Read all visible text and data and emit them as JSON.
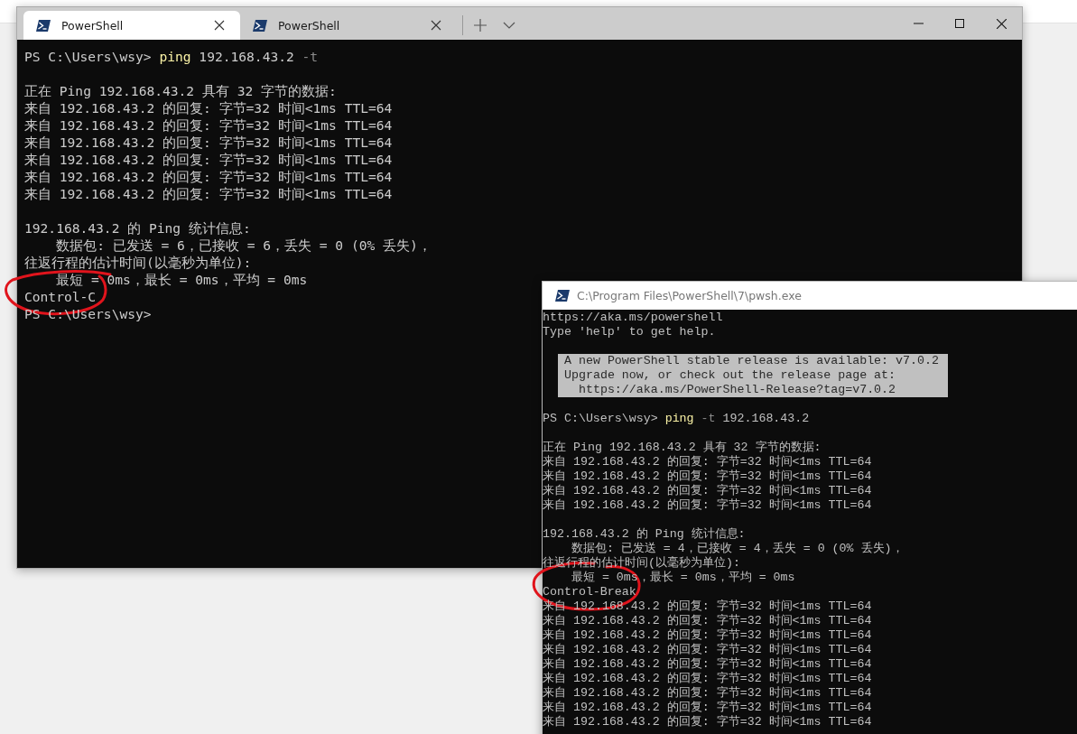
{
  "terminal": {
    "tabs": [
      {
        "title": "PowerShell",
        "selected": true
      },
      {
        "title": "PowerShell",
        "selected": false
      }
    ],
    "lines": [
      {
        "kind": "command",
        "parts": [
          {
            "text": "PS C:\\Users\\wsy>",
            "kind": "word"
          },
          {
            "text": "ping",
            "kind": "command"
          },
          {
            "text": "192.168.43.2",
            "kind": "word"
          },
          {
            "text": "-t",
            "kind": "flag"
          }
        ]
      },
      {
        "kind": "blank"
      },
      {
        "kind": "text",
        "text": "正在 Ping 192.168.43.2 具有 32 字节的数据:"
      },
      {
        "kind": "text",
        "text": "来自 192.168.43.2 的回复: 字节=32 时间<1ms TTL=64"
      },
      {
        "kind": "text",
        "text": "来自 192.168.43.2 的回复: 字节=32 时间<1ms TTL=64"
      },
      {
        "kind": "text",
        "text": "来自 192.168.43.2 的回复: 字节=32 时间<1ms TTL=64"
      },
      {
        "kind": "text",
        "text": "来自 192.168.43.2 的回复: 字节=32 时间<1ms TTL=64"
      },
      {
        "kind": "text",
        "text": "来自 192.168.43.2 的回复: 字节=32 时间<1ms TTL=64"
      },
      {
        "kind": "text",
        "text": "来自 192.168.43.2 的回复: 字节=32 时间<1ms TTL=64"
      },
      {
        "kind": "blank"
      },
      {
        "kind": "text",
        "text": "192.168.43.2 的 Ping 统计信息:"
      },
      {
        "kind": "text",
        "text": "    数据包: 已发送 = 6，已接收 = 6，丢失 = 0 (0% 丢失)，"
      },
      {
        "kind": "text",
        "text": "往返行程的估计时间(以毫秒为单位):"
      },
      {
        "kind": "text",
        "text": "    最短 = 0ms，最长 = 0ms，平均 = 0ms"
      },
      {
        "kind": "text",
        "text": "Control-C"
      },
      {
        "kind": "command",
        "parts": [
          {
            "text": "PS C:\\Users\\wsy>",
            "kind": "word"
          }
        ]
      }
    ]
  },
  "console": {
    "title": "C:\\Program Files\\PowerShell\\7\\pwsh.exe",
    "lines": [
      {
        "kind": "text",
        "text": "https://aka.ms/powershell"
      },
      {
        "kind": "text",
        "text": "Type 'help' to get help."
      },
      {
        "kind": "blank"
      },
      {
        "kind": "notice",
        "lines": [
          "A new PowerShell stable release is available: v7.0.2",
          "Upgrade now, or check out the release page at:",
          "  https://aka.ms/PowerShell-Release?tag=v7.0.2"
        ]
      },
      {
        "kind": "blank"
      },
      {
        "kind": "command",
        "parts": [
          {
            "text": "PS C:\\Users\\wsy>",
            "kind": "word"
          },
          {
            "text": "ping",
            "kind": "command"
          },
          {
            "text": "-t",
            "kind": "flag"
          },
          {
            "text": "192.168.43.2",
            "kind": "word"
          }
        ]
      },
      {
        "kind": "blank"
      },
      {
        "kind": "text",
        "text": "正在 Ping 192.168.43.2 具有 32 字节的数据:"
      },
      {
        "kind": "text",
        "text": "来自 192.168.43.2 的回复: 字节=32 时间<1ms TTL=64"
      },
      {
        "kind": "text",
        "text": "来自 192.168.43.2 的回复: 字节=32 时间<1ms TTL=64"
      },
      {
        "kind": "text",
        "text": "来自 192.168.43.2 的回复: 字节=32 时间<1ms TTL=64"
      },
      {
        "kind": "text",
        "text": "来自 192.168.43.2 的回复: 字节=32 时间<1ms TTL=64"
      },
      {
        "kind": "blank"
      },
      {
        "kind": "text",
        "text": "192.168.43.2 的 Ping 统计信息:"
      },
      {
        "kind": "text",
        "text": "    数据包: 已发送 = 4，已接收 = 4，丢失 = 0 (0% 丢失)，"
      },
      {
        "kind": "text",
        "text": "往返行程的估计时间(以毫秒为单位):"
      },
      {
        "kind": "text",
        "text": "    最短 = 0ms，最长 = 0ms，平均 = 0ms"
      },
      {
        "kind": "text",
        "text": "Control-Break"
      },
      {
        "kind": "text",
        "text": "来自 192.168.43.2 的回复: 字节=32 时间<1ms TTL=64"
      },
      {
        "kind": "text",
        "text": "来自 192.168.43.2 的回复: 字节=32 时间<1ms TTL=64"
      },
      {
        "kind": "text",
        "text": "来自 192.168.43.2 的回复: 字节=32 时间<1ms TTL=64"
      },
      {
        "kind": "text",
        "text": "来自 192.168.43.2 的回复: 字节=32 时间<1ms TTL=64"
      },
      {
        "kind": "text",
        "text": "来自 192.168.43.2 的回复: 字节=32 时间<1ms TTL=64"
      },
      {
        "kind": "text",
        "text": "来自 192.168.43.2 的回复: 字节=32 时间<1ms TTL=64"
      },
      {
        "kind": "text",
        "text": "来自 192.168.43.2 的回复: 字节=32 时间<1ms TTL=64"
      },
      {
        "kind": "text",
        "text": "来自 192.168.43.2 的回复: 字节=32 时间<1ms TTL=64"
      },
      {
        "kind": "text",
        "text": "来自 192.168.43.2 的回复: 字节=32 时间<1ms TTL=64"
      }
    ]
  }
}
